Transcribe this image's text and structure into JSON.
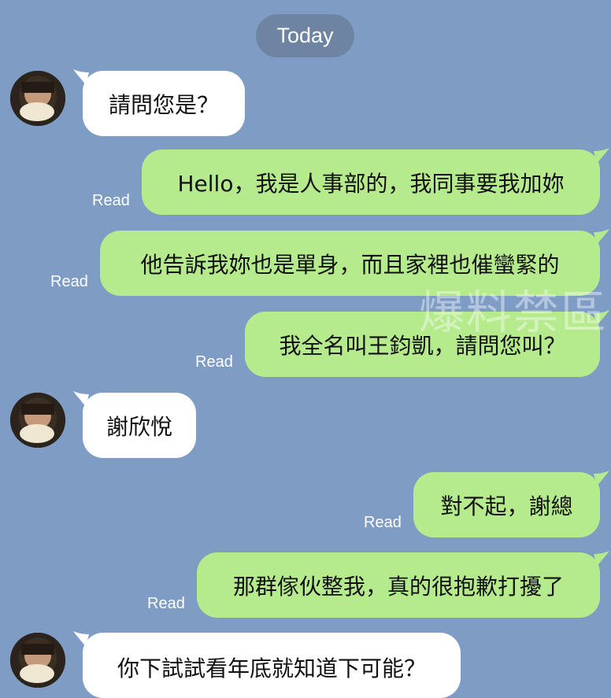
{
  "chat": {
    "date_label": "Today",
    "read_label": "Read",
    "watermark": "爆料禁區",
    "colors": {
      "background": "#7f9dc4",
      "incoming_bubble": "#ffffff",
      "outgoing_bubble": "#b5eb8c",
      "date_pill": "#6e84a3"
    },
    "messages": [
      {
        "direction": "incoming",
        "text": "請問您是？"
      },
      {
        "direction": "outgoing",
        "text": "Hello，我是人事部的，我同事要我加妳",
        "read": "Read"
      },
      {
        "direction": "outgoing",
        "text": "他告訴我妳也是單身，而且家裡也催蠻緊的",
        "read": "Read"
      },
      {
        "direction": "outgoing",
        "text": "我全名叫王鈞凱，請問您叫？",
        "read": "Read"
      },
      {
        "direction": "incoming",
        "text": "謝欣悅"
      },
      {
        "direction": "outgoing",
        "text": "對不起，謝總",
        "read": "Read"
      },
      {
        "direction": "outgoing",
        "text": "那群傢伙整我，真的很抱歉打擾了",
        "read": "Read"
      },
      {
        "direction": "incoming",
        "text": "你下試試看年底就知道下可能？"
      }
    ]
  }
}
